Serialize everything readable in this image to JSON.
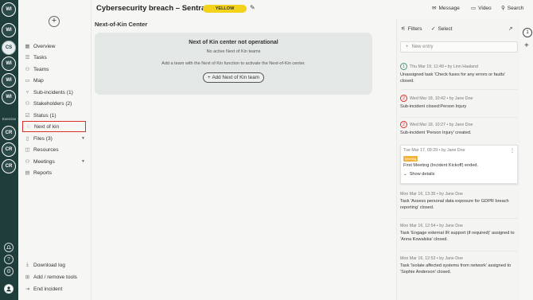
{
  "rail": {
    "avatars_top": [
      "WI",
      "CS",
      "WI",
      "WI",
      "WI"
    ],
    "exercise_label": "Exercise",
    "avatars_bottom": [
      "CR",
      "CR",
      "CR"
    ],
    "bottom_icons": [
      "bell-icon",
      "help-icon",
      "settings-icon",
      "user-icon"
    ]
  },
  "sidebar": {
    "items": [
      {
        "label": "Overview",
        "icon": "grid-icon"
      },
      {
        "label": "Tasks",
        "icon": "list-icon"
      },
      {
        "label": "Teams",
        "icon": "people-icon"
      },
      {
        "label": "Map",
        "icon": "map-icon"
      },
      {
        "label": "Sub-incidents (1)",
        "icon": "branch-icon"
      },
      {
        "label": "Stakeholders (2)",
        "icon": "stakeholders-icon"
      },
      {
        "label": "Status (1)",
        "icon": "check-circle-icon"
      },
      {
        "label": "Next of kin",
        "icon": "heart-icon"
      },
      {
        "label": "Files (3)",
        "icon": "file-icon"
      },
      {
        "label": "Resources",
        "icon": "box-icon"
      },
      {
        "label": "Meetings",
        "icon": "people-icon"
      },
      {
        "label": "Reports",
        "icon": "report-icon"
      }
    ],
    "footer": [
      {
        "label": "Download log",
        "icon": "download-icon"
      },
      {
        "label": "Add / remove tools",
        "icon": "plus-square-icon"
      },
      {
        "label": "End incident",
        "icon": "exit-icon"
      }
    ]
  },
  "header": {
    "title": "Cybersecurity breach – SentraC...",
    "badge": "YELLOW",
    "message_label": "Message",
    "video_label": "Video",
    "search_label": "Search",
    "colors": {
      "badge": "#f2d21a",
      "rail": "#1f3d3b",
      "active_outline": "#d9302c"
    }
  },
  "main": {
    "section_title": "Next-of-Kin Center",
    "notice_title": "Next of Kin center not operational",
    "notice_sub": "No active Next of Kin teams",
    "notice_hint": "Add a team with the Next of Kin function to activate the Next-of-Kin center.",
    "add_button": "Add Next of Kin team"
  },
  "log": {
    "filters_label": "Filters",
    "select_label": "Select",
    "new_entry_placeholder": "New entry",
    "count": "1",
    "entries": [
      {
        "num": "1",
        "meta": "Thu Mar 19, 11:49 • by Linn Haaland",
        "body": "Unassigned task 'Check fuses for any errors or faults' closed."
      },
      {
        "num": "2",
        "meta": "Wed Mar 18, 10:42 • by Jane Doe",
        "body": "Sub-incident closed:Person Injury"
      },
      {
        "num": "2",
        "meta": "Wed Mar 18, 10:27 • by Jane Doe",
        "body": "Sub-incident 'Person Injury' created."
      },
      {
        "meta": "Tue Mar 17, 09:29 • by Jane Doe",
        "tag": "Meeting",
        "body": "First Meeting (Incident Kickoff) ended.",
        "details": "Show details"
      },
      {
        "meta": "Mon Mar 16, 13:35 • by Jane Doe",
        "body": "Task 'Assess personal data exposure for GDPR breach reporting' closed."
      },
      {
        "meta": "Mon Mar 16, 12:54 • by Jane Doe",
        "body": "Task 'Engage external IR support (if required)' assigned to 'Anna Kowalska' closed."
      },
      {
        "meta": "Mon Mar 16, 12:53 • by Jane Doe",
        "body": "Task 'Isolate affected systems from network' assigned to 'Sophie Anderson' closed."
      }
    ]
  }
}
